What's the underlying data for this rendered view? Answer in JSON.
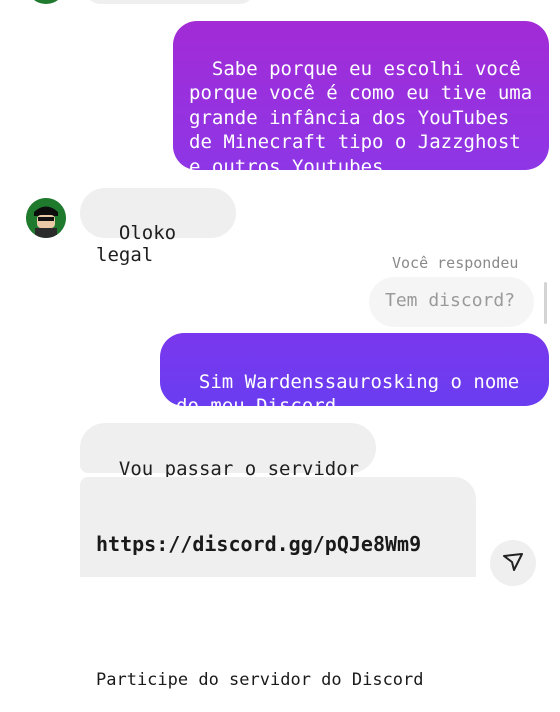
{
  "messages": {
    "m1_text": "Sabe porque eu escolhi você porque você é como eu tive uma grande infância dos YouTubes de Minecraft tipo o Jazzghost e outros Youtubes",
    "m2_text": "Oloko legal",
    "reply_label": "Você respondeu",
    "reply_quote": "Tem discord?",
    "m3_text": "Sim Wardenssaurosking o nome do meu Discord.",
    "m4_text": "Vou passar o servidor",
    "m5_link": "https://discord.gg/pQJe8Wm9",
    "m5_preview": "Participe do servidor do Discord"
  },
  "colors": {
    "outgoing_gradient_top": "#a22bd6",
    "outgoing_gradient_bottom": "#6a3df0",
    "incoming_bg": "#efefef"
  },
  "icons": {
    "avatar": "contact-avatar",
    "share": "share-icon"
  }
}
